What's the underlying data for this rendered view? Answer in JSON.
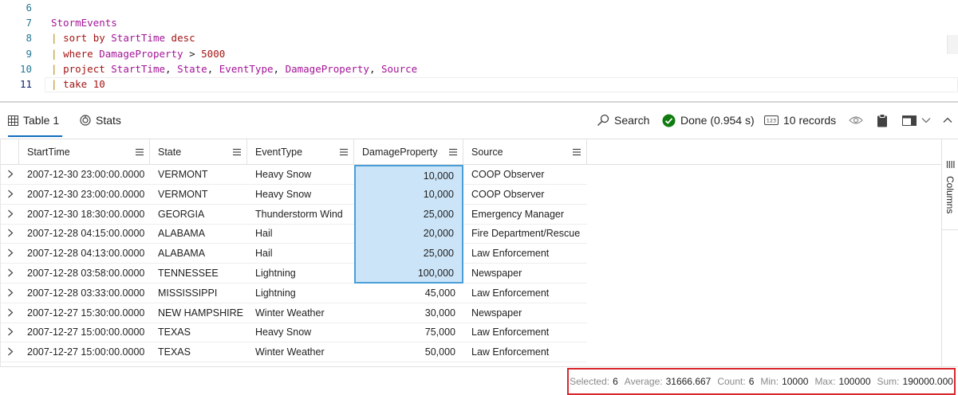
{
  "editor": {
    "lines": [
      {
        "num": "6",
        "tokens": []
      },
      {
        "num": "7",
        "tokens": [
          {
            "t": "StormEvents",
            "c": "kw-tbl"
          }
        ]
      },
      {
        "num": "8",
        "tokens": [
          {
            "t": "| ",
            "c": "pipe"
          },
          {
            "t": "sort by ",
            "c": "kw"
          },
          {
            "t": "StartTime",
            "c": "col"
          },
          {
            "t": " desc",
            "c": "kw"
          }
        ]
      },
      {
        "num": "9",
        "tokens": [
          {
            "t": "| ",
            "c": "pipe"
          },
          {
            "t": "where ",
            "c": "kw"
          },
          {
            "t": "DamageProperty",
            "c": "col"
          },
          {
            "t": " > ",
            "c": "op"
          },
          {
            "t": "5000",
            "c": "num"
          }
        ]
      },
      {
        "num": "10",
        "tokens": [
          {
            "t": "| ",
            "c": "pipe"
          },
          {
            "t": "project ",
            "c": "kw"
          },
          {
            "t": "StartTime",
            "c": "col"
          },
          {
            "t": ", ",
            "c": "op"
          },
          {
            "t": "State",
            "c": "col"
          },
          {
            "t": ", ",
            "c": "op"
          },
          {
            "t": "EventType",
            "c": "col"
          },
          {
            "t": ", ",
            "c": "op"
          },
          {
            "t": "DamageProperty",
            "c": "col"
          },
          {
            "t": ", ",
            "c": "op"
          },
          {
            "t": "Source",
            "c": "col"
          }
        ]
      },
      {
        "num": "11",
        "tokens": [
          {
            "t": "| ",
            "c": "pipe"
          },
          {
            "t": "take ",
            "c": "kw"
          },
          {
            "t": "10",
            "c": "num"
          }
        ]
      }
    ]
  },
  "toolbar": {
    "tab_table": "Table 1",
    "tab_stats": "Stats",
    "search_label": "Search",
    "status_label": "Done (0.954 s)",
    "records_label": "10 records"
  },
  "grid": {
    "columns": [
      "StartTime",
      "State",
      "EventType",
      "DamageProperty",
      "Source"
    ],
    "rows": [
      [
        "2007-12-30 23:00:00.0000",
        "VERMONT",
        "Heavy Snow",
        "10,000",
        "COOP Observer"
      ],
      [
        "2007-12-30 23:00:00.0000",
        "VERMONT",
        "Heavy Snow",
        "10,000",
        "COOP Observer"
      ],
      [
        "2007-12-30 18:30:00.0000",
        "GEORGIA",
        "Thunderstorm Wind",
        "25,000",
        "Emergency Manager"
      ],
      [
        "2007-12-28 04:15:00.0000",
        "ALABAMA",
        "Hail",
        "20,000",
        "Fire Department/Rescue"
      ],
      [
        "2007-12-28 04:13:00.0000",
        "ALABAMA",
        "Hail",
        "25,000",
        "Law Enforcement"
      ],
      [
        "2007-12-28 03:58:00.0000",
        "TENNESSEE",
        "Lightning",
        "100,000",
        "Newspaper"
      ],
      [
        "2007-12-28 03:33:00.0000",
        "MISSISSIPPI",
        "Lightning",
        "45,000",
        "Law Enforcement"
      ],
      [
        "2007-12-27 15:30:00.0000",
        "NEW HAMPSHIRE",
        "Winter Weather",
        "30,000",
        "Newspaper"
      ],
      [
        "2007-12-27 15:00:00.0000",
        "TEXAS",
        "Heavy Snow",
        "75,000",
        "Law Enforcement"
      ],
      [
        "2007-12-27 15:00:00.0000",
        "TEXAS",
        "Winter Weather",
        "50,000",
        "Law Enforcement"
      ]
    ],
    "selected_rows": 6,
    "side_panel_label": "Columns"
  },
  "statusbar": {
    "selected_label": "Selected:",
    "selected_value": "6",
    "average_label": "Average:",
    "average_value": "31666.667",
    "count_label": "Count:",
    "count_value": "6",
    "min_label": "Min:",
    "min_value": "10000",
    "max_label": "Max:",
    "max_value": "100000",
    "sum_label": "Sum:",
    "sum_value": "190000.000"
  },
  "colors": {
    "accent": "#0f6cbd",
    "done_green": "#107c10",
    "selection_fill": "#cce4f7",
    "selection_border": "#4a9ed8",
    "highlight_border": "#d9262c"
  },
  "icons": {
    "table": "table-icon",
    "stats": "stats-icon",
    "search": "search-icon",
    "done": "checkmark-circle-icon",
    "records": "record-count-icon",
    "visibility": "eye-icon",
    "copy": "clipboard-icon",
    "layout": "panel-layout-icon",
    "collapse": "chevron-up-icon",
    "column_menu": "hamburger-menu-icon",
    "expand_row": "chevron-right-icon",
    "columns_panel": "columns-icon"
  }
}
